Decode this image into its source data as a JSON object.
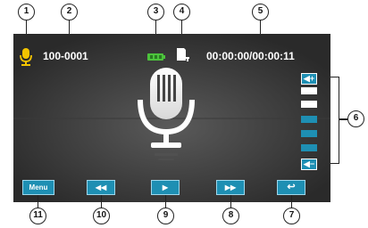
{
  "callouts": [
    "1",
    "2",
    "3",
    "4",
    "5",
    "6",
    "7",
    "8",
    "9",
    "10",
    "11"
  ],
  "status": {
    "file_number": "100-0001",
    "time": "00:00:00/00:00:11",
    "battery_color": "#4cc33c"
  },
  "volume": {
    "up_label": "◀+",
    "down_label": "◀−",
    "level_segments": 5,
    "filled_segments": 2,
    "filled_color": "#ffffff",
    "empty_color": "#1e8fb3"
  },
  "buttons": {
    "menu": "Menu",
    "rewind": "◀◀",
    "play": "▶",
    "forward": "▶▶",
    "back": "↩"
  },
  "icons": {
    "record": "microphone-icon",
    "center": "large-microphone-icon",
    "sd": "sd-card-icon",
    "battery": "battery-icon"
  }
}
